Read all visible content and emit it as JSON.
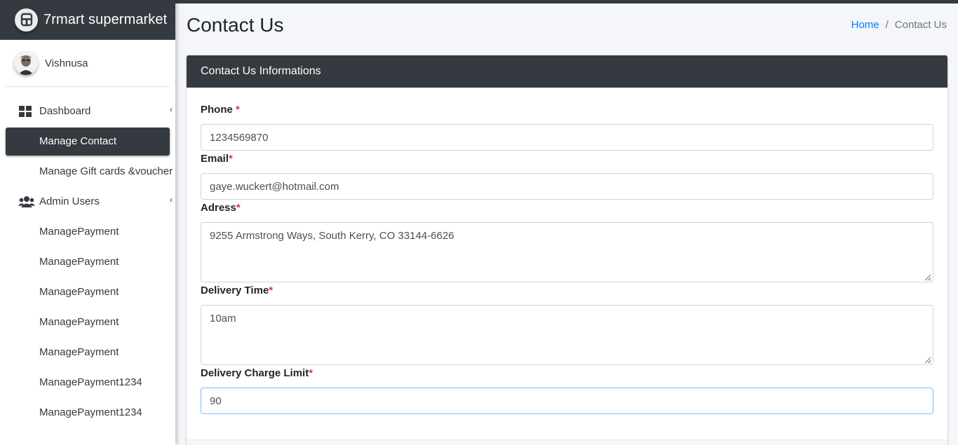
{
  "brand": {
    "name": "7rmart supermarket"
  },
  "user": {
    "name": "Vishnusa"
  },
  "sidebar": {
    "items": [
      {
        "label": "Dashboard",
        "icon": "dashboard-icon",
        "caret": "‹"
      },
      {
        "label": "Manage Contact"
      },
      {
        "label": "Manage Gift cards &voucher"
      },
      {
        "label": "Admin Users",
        "icon": "users-icon",
        "caret": "‹"
      },
      {
        "label": "ManagePayment"
      },
      {
        "label": "ManagePayment"
      },
      {
        "label": "ManagePayment"
      },
      {
        "label": "ManagePayment"
      },
      {
        "label": "ManagePayment"
      },
      {
        "label": "ManagePayment1234"
      },
      {
        "label": "ManagePayment1234"
      }
    ]
  },
  "header": {
    "title": "Contact Us",
    "breadcrumb": {
      "home": "Home",
      "separator": "/",
      "current": "Contact Us"
    }
  },
  "card": {
    "title": "Contact Us Informations",
    "fields": {
      "phone": {
        "label": "Phone",
        "required": "*",
        "value": "1234569870"
      },
      "email": {
        "label": "Email",
        "required": "*",
        "value": "gaye.wuckert@hotmail.com"
      },
      "address": {
        "label": "Adress",
        "required": "*",
        "value": "9255 Armstrong Ways, South Kerry, CO 33144-6626"
      },
      "delivery_time": {
        "label": "Delivery Time",
        "required": "*",
        "value": "10am"
      },
      "delivery_charge_limit": {
        "label": "Delivery Charge Limit",
        "required": "*",
        "value": "90"
      }
    }
  },
  "colors": {
    "sidebar_dark": "#343a40",
    "link": "#007bff",
    "required": "#dc3545",
    "focus_border": "#80bdff"
  }
}
